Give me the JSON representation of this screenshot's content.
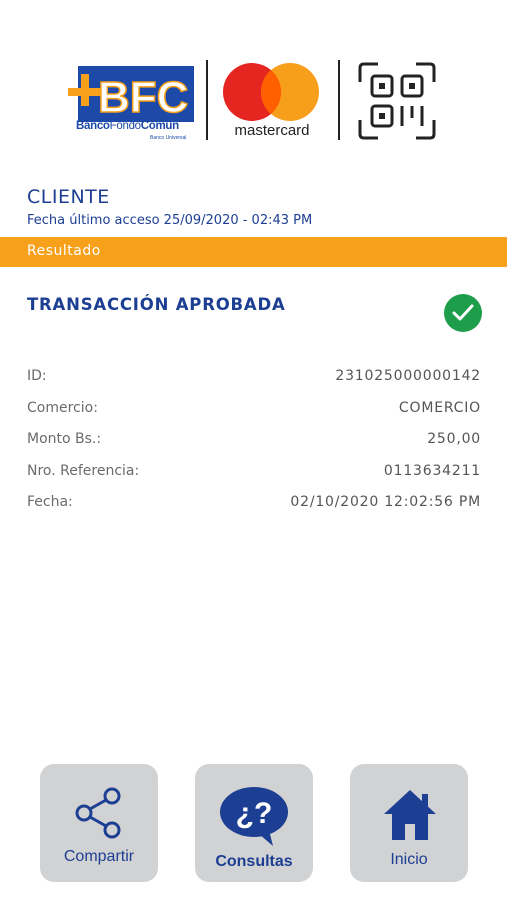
{
  "header": {
    "bank_name_bold": "Banco",
    "bank_name_light": "Fondo",
    "bank_name_rest": "Común",
    "bank_subtitle": "Banco Universal",
    "card_brand": "mastercard"
  },
  "client": {
    "title": "CLIENTE",
    "last_access": "Fecha último acceso 25/09/2020 - 02:43 PM"
  },
  "section_bar": {
    "label": "Resultado"
  },
  "result": {
    "status": "TRANSACCIÓN APROBADA",
    "details": [
      {
        "label": "ID:",
        "value": "231025000000142"
      },
      {
        "label": "Comercio:",
        "value": "COMERCIO"
      },
      {
        "label": "Monto Bs.:",
        "value": "250,00"
      },
      {
        "label": "Nro. Referencia:",
        "value": "0113634211"
      },
      {
        "label": "Fecha:",
        "value": "02/10/2020 12:02:56 PM"
      }
    ]
  },
  "actions": {
    "share_label": "Compartir",
    "queries_label": "Consultas",
    "home_label": "Inicio"
  },
  "colors": {
    "brand_blue": "#1d3f93",
    "accent_orange": "#f7a11a",
    "success_green": "#1e9e4a",
    "button_gray": "#d1d2d4"
  }
}
